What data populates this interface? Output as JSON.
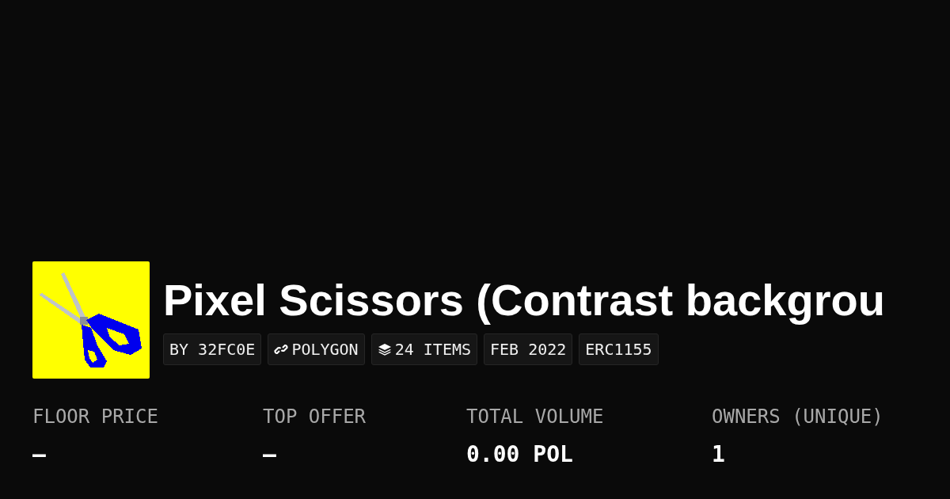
{
  "collection": {
    "title": "Pixel Scissors (Contrast backgrou",
    "tags": [
      {
        "kind": "text",
        "label": "BY 32FC0E"
      },
      {
        "kind": "chain",
        "label": "POLYGON"
      },
      {
        "kind": "items",
        "label": "24 ITEMS"
      },
      {
        "kind": "text",
        "label": "FEB 2022"
      },
      {
        "kind": "text",
        "label": "ERC1155"
      }
    ]
  },
  "stats": [
    {
      "label": "FLOOR PRICE",
      "value": "–"
    },
    {
      "label": "TOP OFFER",
      "value": "–"
    },
    {
      "label": "TOTAL VOLUME",
      "value": "0.00 POL"
    },
    {
      "label": "OWNERS (UNIQUE)",
      "value": "1"
    }
  ]
}
